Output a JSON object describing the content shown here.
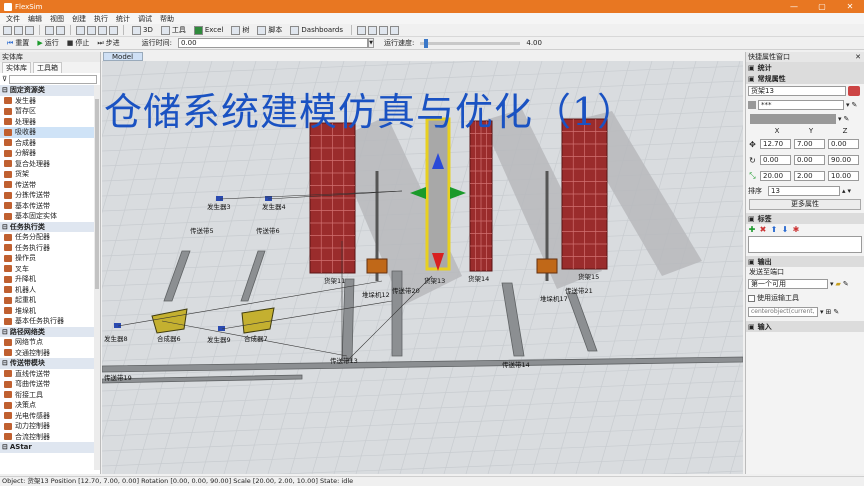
{
  "window": {
    "title": "FlexSim"
  },
  "menu": [
    "文件",
    "编辑",
    "视图",
    "创建",
    "执行",
    "统计",
    "调试",
    "帮助"
  ],
  "toolbar": {
    "view3d": "3D",
    "tools": "工具",
    "excel": "Excel",
    "tree": "树",
    "script": "脚本",
    "dashboards": "Dashboards"
  },
  "runbar": {
    "reset": "重置",
    "run": "运行",
    "stop": "停止",
    "step": "步进",
    "run_time_label": "运行时间:",
    "run_time_value": "0.00",
    "speed_label": "运行速度:",
    "speed_value": "4.00",
    "speed_fraction": 0.04
  },
  "library": {
    "title": "实体库",
    "tabs": [
      "实体库",
      "工具箱"
    ],
    "groups": [
      {
        "name": "固定资源类",
        "items": [
          "发生器",
          "暂存区",
          "处理器",
          "吸收器",
          "合成器",
          "分解器",
          "复合处理器",
          "货架",
          "传送带",
          "分拣传送带",
          "基本传送带",
          "基本固定实体"
        ]
      },
      {
        "name": "任务执行类",
        "items": [
          "任务分配器",
          "任务执行器",
          "操作员",
          "叉车",
          "升降机",
          "机器人",
          "起重机",
          "堆垛机",
          "基本任务执行器"
        ]
      },
      {
        "name": "路径网络类",
        "items": [
          "网络节点",
          "交通控制器"
        ]
      },
      {
        "name": "传送带模块",
        "items": [
          "直线传送带",
          "弯曲传送带",
          "衔接工具",
          "决策点",
          "光电传感器",
          "动力控制器",
          "合流控制器"
        ]
      },
      {
        "name": "AStar",
        "items": []
      }
    ],
    "selected_item": "吸收器"
  },
  "view": {
    "tab": "Model",
    "banner": "仓储系统建模仿真与优化（1）",
    "labels": {
      "src3": "发生器3",
      "src4": "发生器4",
      "src8": "发生器8",
      "src9": "发生器9",
      "cv5": "传送带5",
      "cv6": "传送带6",
      "cv13": "传送带13",
      "cv14": "传送带14",
      "cv19": "传送带19",
      "cv20": "传送带20",
      "cv21": "传送带21",
      "rack11": "货架11",
      "rack13": "货架13",
      "rack14": "货架14",
      "rack15": "货架15",
      "asrs12": "堆垛机12",
      "asrs17": "堆垛机17",
      "comb6": "合成器6",
      "comb7": "合成器7"
    }
  },
  "properties": {
    "title": "快捷属性窗口",
    "sections": {
      "stats": "统计",
      "general": "常规属性",
      "labels": "标签",
      "output": "输出",
      "input": "输入"
    },
    "name": "货架13",
    "type_value": "***",
    "xyz_headers": [
      "X",
      "Y",
      "Z"
    ],
    "position": [
      "12.70",
      "7.00",
      "0.00"
    ],
    "rotation": [
      "0.00",
      "0.00",
      "90.00"
    ],
    "size": [
      "20.00",
      "2.00",
      "10.00"
    ],
    "rank_label": "排序",
    "rank_value": "13",
    "more_button": "更多属性",
    "send_to_label": "发送至端口",
    "send_to_value": "第一个可用",
    "use_transport_label": "使用运输工具",
    "transport_value": "centerobject(current, 1)"
  },
  "status": {
    "text": "Object: 货架13 Position [12.70, 7.00, 0.00]  Rotation [0.00, 0.00, 90.00]  Scale [20.00, 2.00, 10.00]  State: idle"
  },
  "colors": {
    "titlebar": "#e87722",
    "banner_text": "#1a52c2",
    "rack": "#a03030",
    "selection": "#e8d020"
  }
}
